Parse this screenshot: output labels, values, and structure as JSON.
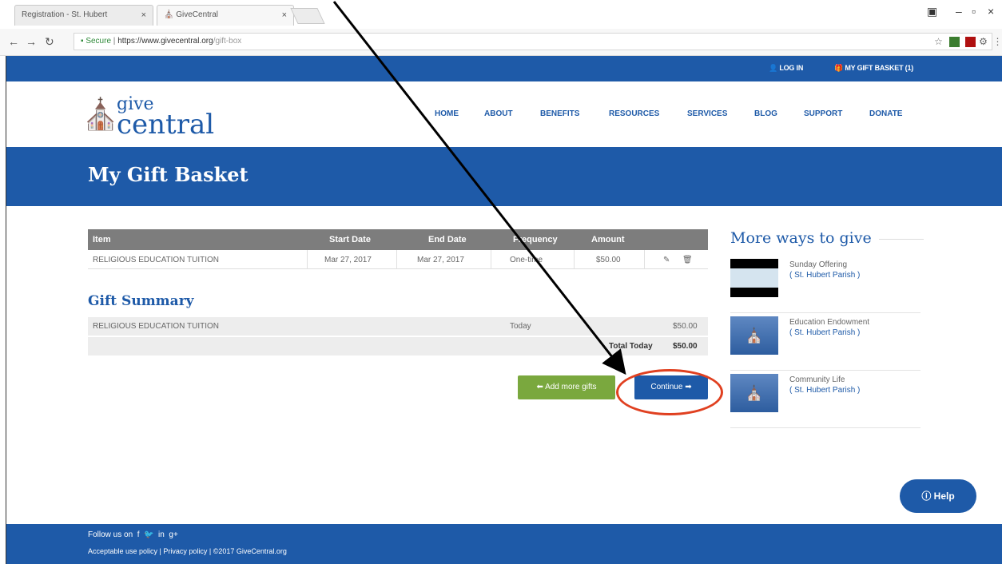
{
  "browser": {
    "tabs": [
      {
        "title": "Registration - St. Hubert"
      },
      {
        "title": "GiveCentral"
      }
    ],
    "url_secure": "Secure",
    "url_host": "https://www.givecentral.org",
    "url_path": "/gift-box"
  },
  "topbar": {
    "login": "LOG IN",
    "basket": "MY GIFT BASKET (1)"
  },
  "logo": {
    "give": "give",
    "central": "central"
  },
  "nav": [
    "HOME",
    "ABOUT",
    "BENEFITS",
    "RESOURCES",
    "SERVICES",
    "BLOG",
    "SUPPORT",
    "DONATE"
  ],
  "page_title": "My Gift Basket",
  "table": {
    "headers": [
      "Item",
      "Start Date",
      "End Date",
      "Frequency",
      "Amount"
    ],
    "rows": [
      {
        "item": "RELIGIOUS EDUCATION TUITION",
        "start": "Mar 27, 2017",
        "end": "Mar 27, 2017",
        "frequency": "One-time",
        "amount": "$50.00"
      }
    ]
  },
  "summary": {
    "title": "Gift Summary",
    "item": "RELIGIOUS EDUCATION TUITION",
    "when": "Today",
    "amount": "$50.00",
    "total_label": "Total Today",
    "total_amount": "$50.00"
  },
  "buttons": {
    "add_more": "Add more gifts",
    "continue": "Continue"
  },
  "sidebar": {
    "title": "More ways to give",
    "items": [
      {
        "name": "Sunday Offering",
        "org": "( St. Hubert Parish )"
      },
      {
        "name": "Education Endowment",
        "org": "( St. Hubert Parish )"
      },
      {
        "name": "Community Life",
        "org": "( St. Hubert Parish )"
      }
    ]
  },
  "help": "Help",
  "footer": {
    "follow": "Follow us on",
    "links": "Acceptable use policy | Privacy policy | ©2017 GiveCentral.org"
  },
  "colors": {
    "brand_blue": "#1e5aa8",
    "green": "#7aa83e",
    "annotation_red": "#e04020"
  }
}
